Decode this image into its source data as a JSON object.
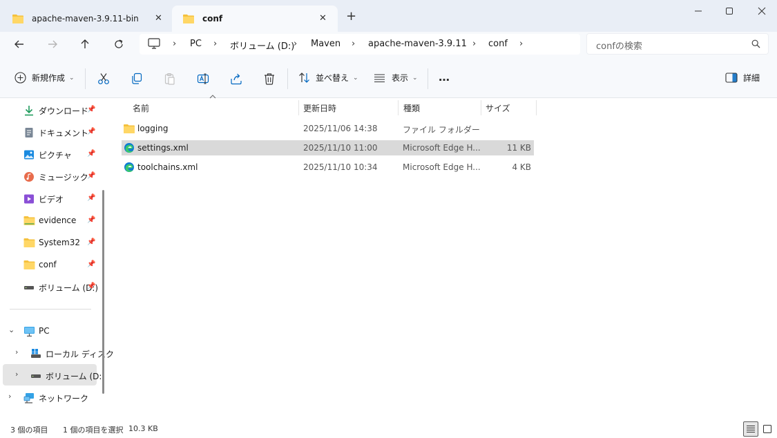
{
  "tabs": [
    {
      "label": "apache-maven-3.9.11-bin",
      "close": "✕"
    },
    {
      "label": "conf",
      "close": "✕"
    }
  ],
  "new_tab": "+",
  "window_controls": {
    "minimize": "—",
    "maximize": "☐",
    "close": "✕"
  },
  "breadcrumb": [
    "PC",
    "ボリューム (D:)",
    "Maven",
    "apache-maven-3.9.11",
    "conf"
  ],
  "breadcrumb_separator": "›",
  "search": {
    "placeholder": "confの検索"
  },
  "toolbar": {
    "new_label": "新規作成",
    "sort_label": "並べ替え",
    "view_label": "表示",
    "more_label": "…",
    "details_label": "詳細",
    "caret": "⌄"
  },
  "quick_access": [
    {
      "label": "ダウンロード",
      "icon": "download-icon",
      "pin": "📌"
    },
    {
      "label": "ドキュメント",
      "icon": "document-icon",
      "pin": "📌"
    },
    {
      "label": "ピクチャ",
      "icon": "pictures-icon",
      "pin": "📌"
    },
    {
      "label": "ミュージック",
      "icon": "music-icon",
      "pin": "📌"
    },
    {
      "label": "ビデオ",
      "icon": "video-icon",
      "pin": "📌"
    },
    {
      "label": "evidence",
      "icon": "folder-icon",
      "pin": "📌"
    },
    {
      "label": "System32",
      "icon": "folder-icon",
      "pin": "📌"
    },
    {
      "label": "conf",
      "icon": "folder-icon",
      "pin": "📌"
    },
    {
      "label": "ボリューム (D:)",
      "icon": "drive-icon",
      "pin": "📌"
    }
  ],
  "tree": [
    {
      "label": "PC",
      "icon": "pc-icon",
      "chevron": "⌄"
    },
    {
      "label": "ローカル ディスク",
      "icon": "disk-icon",
      "chevron": "›"
    },
    {
      "label": "ボリューム (D:)",
      "icon": "drive-icon",
      "chevron": "›"
    },
    {
      "label": "ネットワーク",
      "icon": "network-icon",
      "chevron": "›"
    }
  ],
  "columns": {
    "name": "名前",
    "date": "更新日時",
    "type": "種類",
    "size": "サイズ"
  },
  "files": [
    {
      "name": "logging",
      "date": "2025/11/06 14:38",
      "type": "ファイル フォルダー",
      "size": "",
      "icon": "folder-icon"
    },
    {
      "name": "settings.xml",
      "date": "2025/11/10 11:00",
      "type": "Microsoft Edge H...",
      "size": "11 KB",
      "icon": "edge-icon",
      "selected": true
    },
    {
      "name": "toolchains.xml",
      "date": "2025/11/10 10:34",
      "type": "Microsoft Edge H...",
      "size": "4 KB",
      "icon": "edge-icon"
    }
  ],
  "status": {
    "item_count": "3 個の項目",
    "selected": "1 個の項目を選択",
    "selected_size": "10.3 KB"
  },
  "colors": {
    "folder": "#f5c13d",
    "accent": "#0067c0",
    "selection": "#d9d9d9"
  }
}
